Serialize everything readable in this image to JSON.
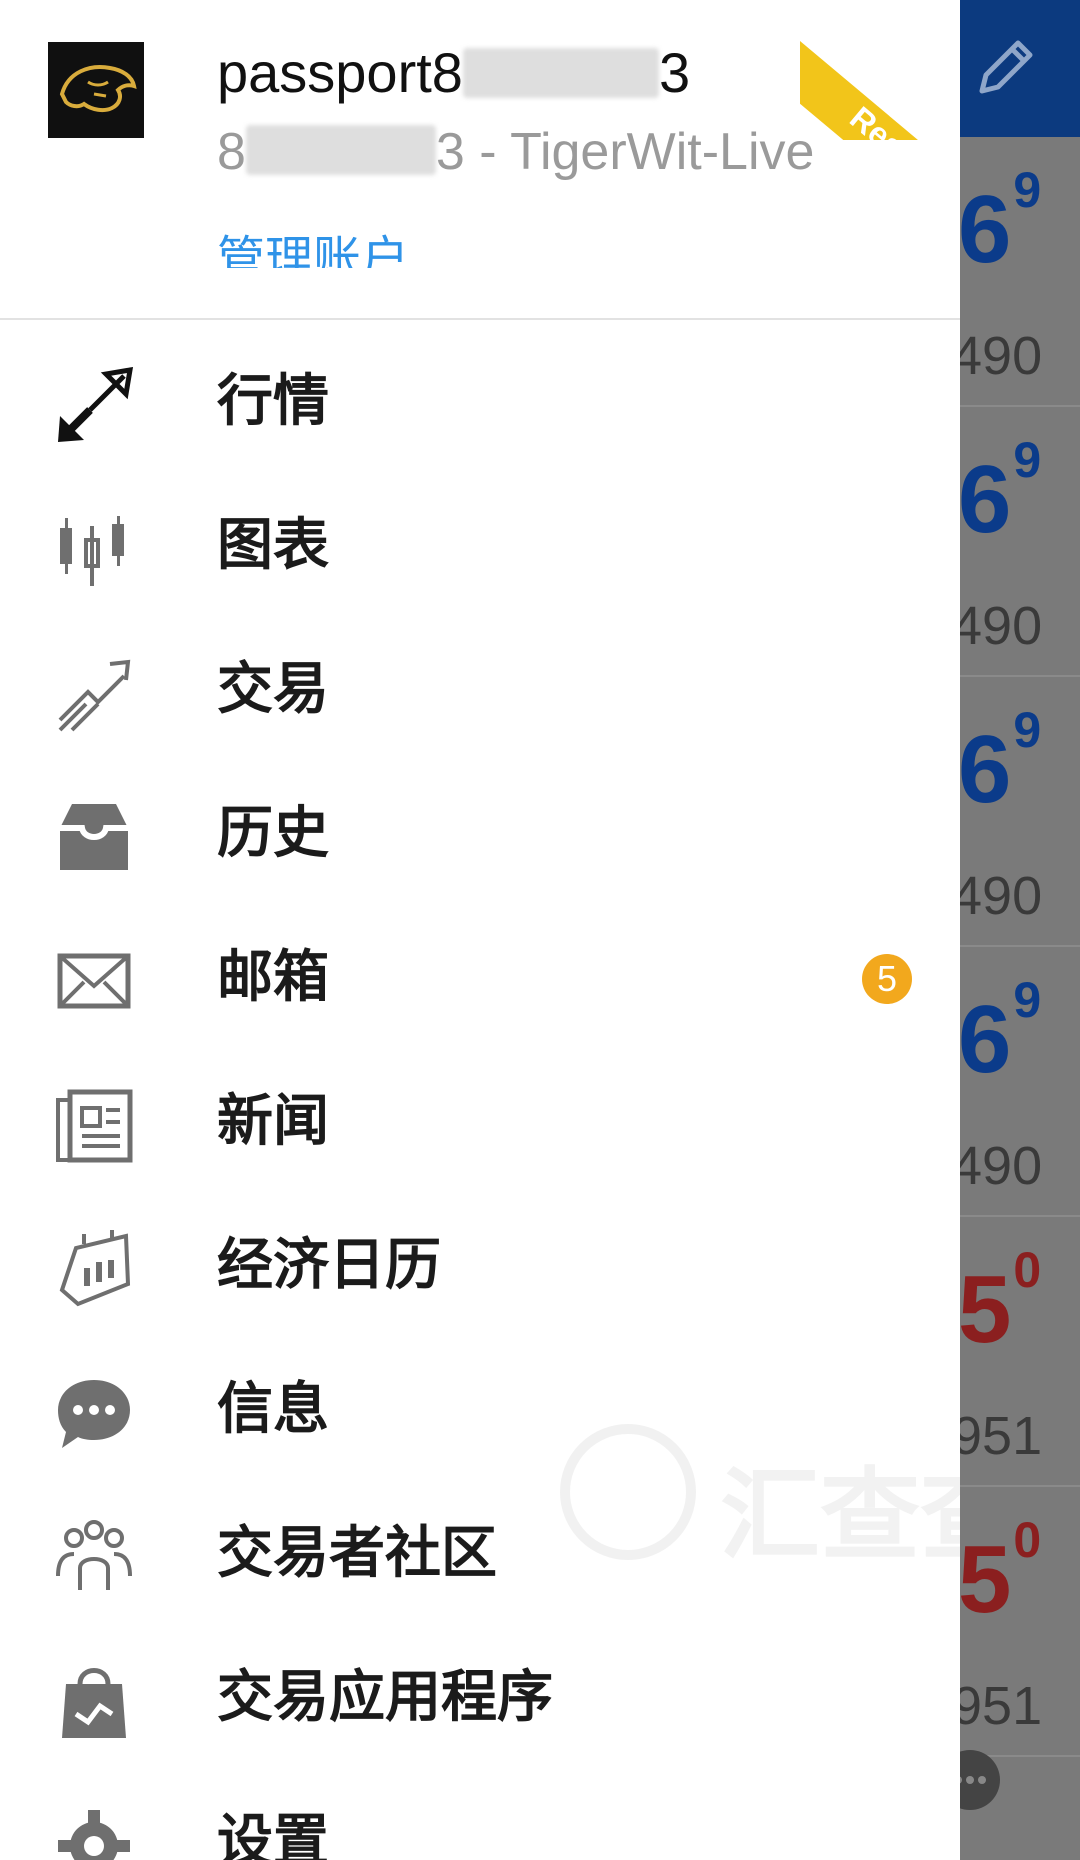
{
  "background": {
    "rows": [
      {
        "bid_main": "6",
        "bid_sup": "9",
        "sub": "490",
        "direction": "up"
      },
      {
        "bid_main": "6",
        "bid_sup": "9",
        "sub": "490",
        "direction": "up"
      },
      {
        "bid_main": "6",
        "bid_sup": "9",
        "sub": "490",
        "direction": "up"
      },
      {
        "bid_main": "6",
        "bid_sup": "9",
        "sub": "490",
        "direction": "up"
      },
      {
        "bid_main": "5",
        "bid_sup": "0",
        "sub": "951",
        "direction": "down"
      },
      {
        "bid_main": "5",
        "bid_sup": "0",
        "sub": "951",
        "direction": "down"
      }
    ],
    "colors": {
      "topbar": "#0c3a7f",
      "up": "#0b3b8a",
      "down": "#8b1f1f",
      "dim": "#7a7a7a"
    }
  },
  "drawer": {
    "username_prefix": "passport8",
    "username_suffix": "3",
    "account_prefix": "8",
    "account_suffix": "3 - TigerWit-Live",
    "manage_label": "管理账户",
    "real_badge": "Real",
    "menu": [
      {
        "label": "行情",
        "icon": "quotes-arrows-icon"
      },
      {
        "label": "图表",
        "icon": "candlestick-chart-icon"
      },
      {
        "label": "交易",
        "icon": "trade-trend-icon"
      },
      {
        "label": "历史",
        "icon": "history-tray-icon"
      },
      {
        "label": "邮箱",
        "icon": "mail-icon",
        "badge": "5"
      },
      {
        "label": "新闻",
        "icon": "news-icon"
      },
      {
        "label": "经济日历",
        "icon": "economic-calendar-icon"
      },
      {
        "label": "信息",
        "icon": "chat-bubble-icon"
      },
      {
        "label": "交易者社区",
        "icon": "community-icon"
      },
      {
        "label": "交易应用程序",
        "icon": "trading-apps-bag-icon"
      },
      {
        "label": "设置",
        "icon": "settings-gear-icon"
      }
    ]
  },
  "watermark": {
    "text": "汇查查"
  }
}
